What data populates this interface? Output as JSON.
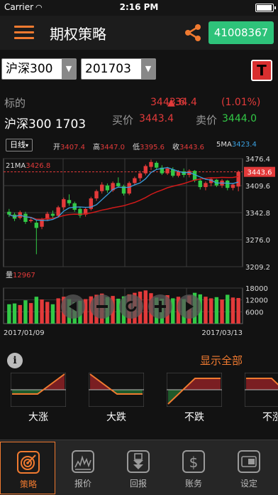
{
  "status_bar": {
    "carrier": "Carrier",
    "time": "2:16 PM"
  },
  "header": {
    "title": "期权策略",
    "account": "41008367",
    "menu_icon": "menu-icon",
    "share_icon": "share-icon"
  },
  "selectors": {
    "underlying": "沪深300",
    "contract": "201703",
    "trade_badge": "T"
  },
  "quote": {
    "label": "标的",
    "name": "沪深300 1703",
    "price": "3443.6",
    "change": "▲34.4",
    "change_pct": "(1.01%)",
    "buy_label": "买价",
    "buy_value": "3443.4",
    "sell_label": "卖价",
    "sell_value": "3444.0"
  },
  "chart_info": {
    "period": "日线",
    "open_label": "开",
    "open": "3407.4",
    "high_label": "高",
    "high": "3447.0",
    "low_label": "低",
    "low": "3395.6",
    "close_label": "收",
    "close": "3443.6",
    "ma5_label": "5MA",
    "ma5": "3423.4"
  },
  "chart_data": {
    "type": "candlestick",
    "ma21_label": "21MA",
    "ma21": "3426.8",
    "price_axis": [
      "3476.4",
      "3443.6",
      "3409.6",
      "3342.8",
      "3276.0",
      "3209.2"
    ],
    "current_price": 3443.6,
    "ylim": [
      3209.2,
      3476.4
    ],
    "volume_label": "量",
    "volume": "12967",
    "volume_axis": [
      "18000",
      "12000",
      "6000"
    ],
    "volume_ylim": [
      0,
      18000
    ],
    "date_start": "2017/01/09",
    "date_end": "2017/03/13",
    "candles": [
      [
        3345,
        3352,
        3332,
        3338
      ],
      [
        3338,
        3343,
        3322,
        3328
      ],
      [
        3330,
        3348,
        3326,
        3344
      ],
      [
        3340,
        3345,
        3315,
        3320
      ],
      [
        3322,
        3332,
        3318,
        3325
      ],
      [
        3318,
        3324,
        3240,
        3305
      ],
      [
        3308,
        3330,
        3302,
        3326
      ],
      [
        3326,
        3345,
        3322,
        3340
      ],
      [
        3340,
        3348,
        3330,
        3335
      ],
      [
        3335,
        3360,
        3332,
        3356
      ],
      [
        3356,
        3380,
        3350,
        3376
      ],
      [
        3374,
        3388,
        3360,
        3366
      ],
      [
        3366,
        3370,
        3345,
        3350
      ],
      [
        3352,
        3356,
        3330,
        3336
      ],
      [
        3338,
        3355,
        3333,
        3352
      ],
      [
        3352,
        3382,
        3348,
        3378
      ],
      [
        3378,
        3400,
        3372,
        3396
      ],
      [
        3396,
        3418,
        3390,
        3412
      ],
      [
        3410,
        3415,
        3392,
        3398
      ],
      [
        3398,
        3420,
        3394,
        3416
      ],
      [
        3416,
        3430,
        3405,
        3408
      ],
      [
        3408,
        3412,
        3385,
        3390
      ],
      [
        3390,
        3420,
        3386,
        3416
      ],
      [
        3416,
        3432,
        3410,
        3428
      ],
      [
        3428,
        3446,
        3420,
        3440
      ],
      [
        3440,
        3462,
        3435,
        3458
      ],
      [
        3456,
        3474,
        3448,
        3468
      ],
      [
        3466,
        3470,
        3450,
        3454
      ],
      [
        3454,
        3460,
        3436,
        3440
      ],
      [
        3440,
        3456,
        3436,
        3452
      ],
      [
        3450,
        3455,
        3430,
        3434
      ],
      [
        3434,
        3448,
        3430,
        3445
      ],
      [
        3445,
        3452,
        3430,
        3436
      ],
      [
        3436,
        3450,
        3430,
        3446
      ],
      [
        3446,
        3448,
        3418,
        3422
      ],
      [
        3422,
        3428,
        3400,
        3406
      ],
      [
        3406,
        3420,
        3398,
        3416
      ],
      [
        3416,
        3430,
        3408,
        3426
      ],
      [
        3424,
        3426,
        3406,
        3410
      ],
      [
        3410,
        3426,
        3404,
        3422
      ],
      [
        3422,
        3424,
        3398,
        3404
      ],
      [
        3404,
        3416,
        3398,
        3412
      ],
      [
        3407.4,
        3447.0,
        3395.6,
        3443.6
      ]
    ],
    "volumes": [
      9800,
      10200,
      9400,
      11800,
      10400,
      13600,
      12200,
      11000,
      9800,
      12800,
      13600,
      12400,
      10800,
      11600,
      12400,
      13800,
      14600,
      15200,
      13400,
      14000,
      12600,
      13800,
      14800,
      15600,
      16200,
      16800,
      15400,
      13200,
      12600,
      14400,
      12800,
      13600,
      12400,
      14200,
      15600,
      14800,
      13600,
      12800,
      13400,
      12200,
      14600,
      13200,
      12967
    ]
  },
  "chart_controls": [
    "left-arrow",
    "zoom-out",
    "reset",
    "zoom-in",
    "right-arrow"
  ],
  "strategy_section": {
    "show_all": "显示全部",
    "items": [
      {
        "label": "大涨",
        "shape": "bull"
      },
      {
        "label": "大跌",
        "shape": "bear"
      },
      {
        "label": "不跌",
        "shape": "notfall"
      },
      {
        "label": "不涨",
        "shape": "notrise"
      }
    ]
  },
  "nav": [
    {
      "label": "策略",
      "icon": "target-icon",
      "active": true
    },
    {
      "label": "报价",
      "icon": "quote-chart-icon",
      "active": false
    },
    {
      "label": "回报",
      "icon": "return-icon",
      "active": false
    },
    {
      "label": "账务",
      "icon": "dollar-icon",
      "active": false
    },
    {
      "label": "设定",
      "icon": "settings-icon",
      "active": false
    }
  ]
}
